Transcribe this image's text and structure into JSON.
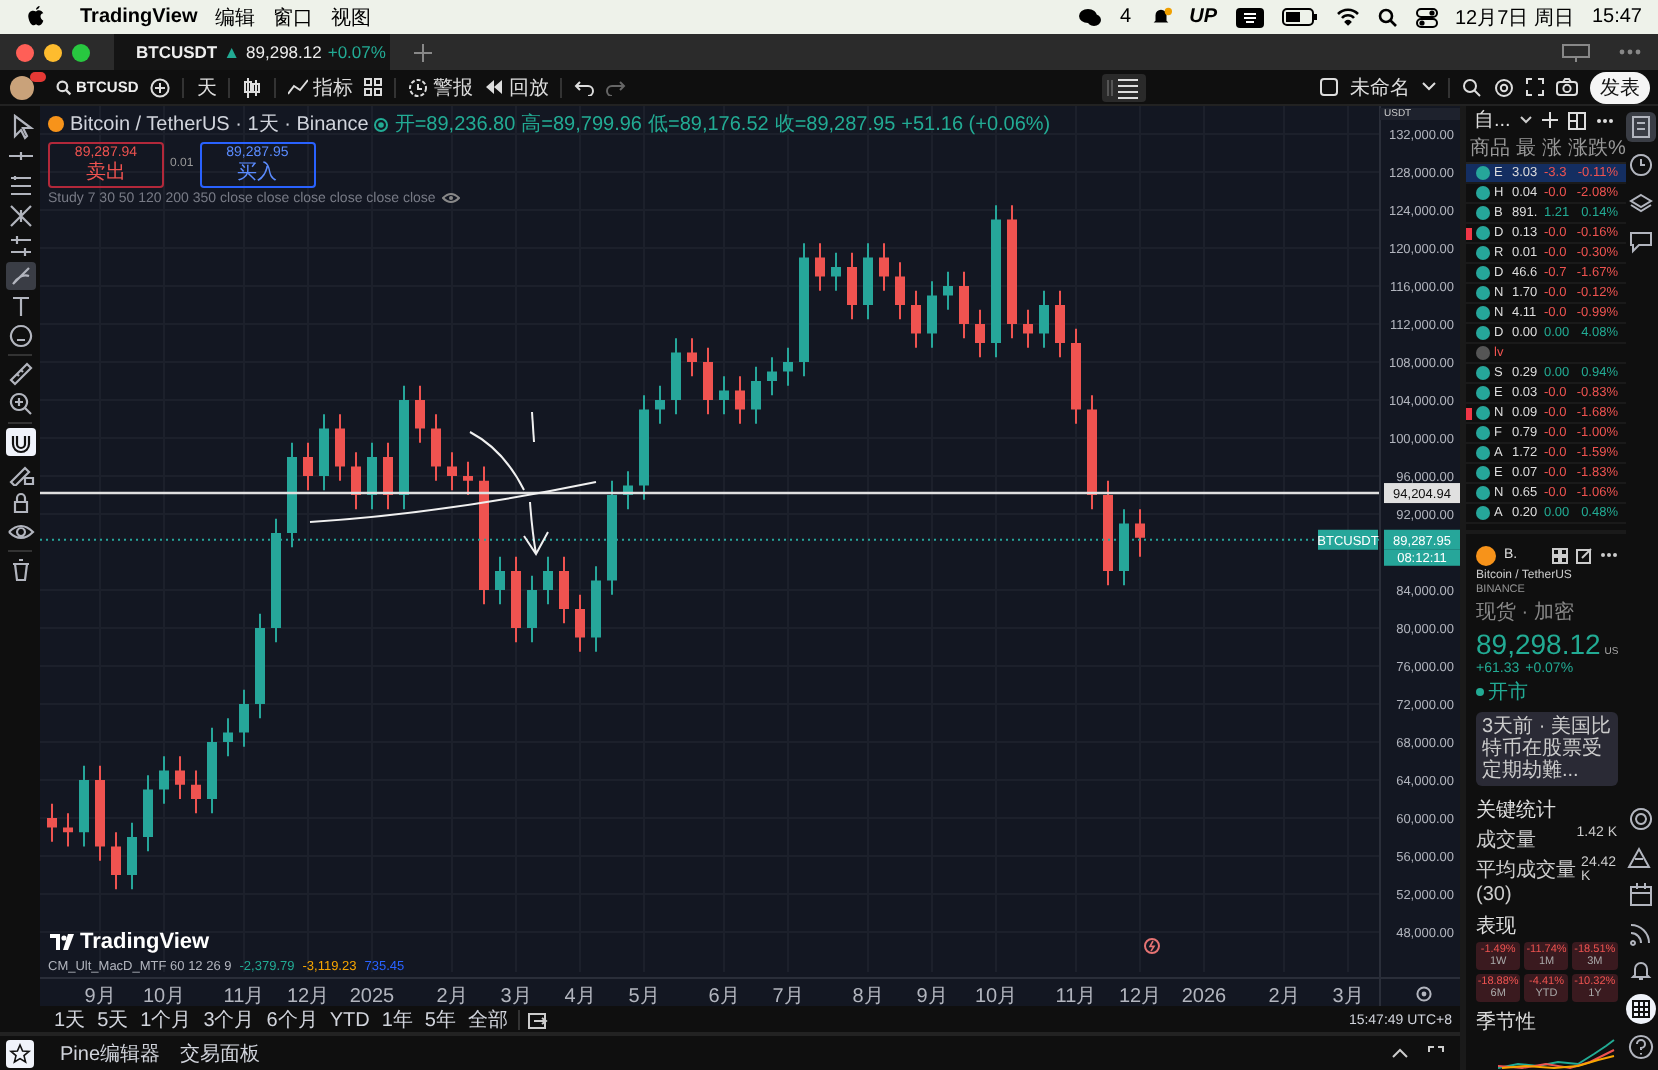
{
  "menu_bar": {
    "app": "TradingView",
    "menus": [
      "编辑",
      "窗口",
      "视图"
    ],
    "wechat_count": "4",
    "up_label": "UP",
    "date": "12月7日 周日",
    "time": "15:47"
  },
  "tab": {
    "symbol": "BTCUSDT",
    "arrow": "▲",
    "price": "89,298.12",
    "change": "+0.07%"
  },
  "toolbar": {
    "symbol": "BTCUSD",
    "interval": "天",
    "indicators": "指标",
    "alert": "警报",
    "replay": "回放",
    "layout_name": "未命名",
    "publish": "发表"
  },
  "drawing_tools": {
    "items": [
      {
        "selected": false
      },
      {
        "selected": false
      },
      {
        "selected": false
      },
      {
        "selected": false
      },
      {
        "selected": false
      },
      {
        "selected": true
      },
      {
        "selected": false
      },
      {
        "selected": false
      },
      {
        "selected": false
      },
      {
        "selected": false
      },
      {
        "selected": true
      },
      {
        "selected": false
      },
      {
        "selected": false
      },
      {
        "selected": false
      },
      {
        "selected": false
      }
    ]
  },
  "chart": {
    "legend": {
      "title": "Bitcoin / TetherUS · 1天 · Binance",
      "ohlc": [
        "开=89,236.80",
        "高=89,799.96",
        "低=89,176.52",
        "收=89,287.95"
      ],
      "change": "+51.16 (+0.06%)",
      "sell": {
        "price": "89,287.94",
        "label": "卖出"
      },
      "spread": "0.01",
      "buy": {
        "price": "89,287.95",
        "label": "买入"
      },
      "study": "Study 7 30 50 120 200 350 close close close close close close"
    },
    "unit": "USDT",
    "logo": "TradingView",
    "price_tag": {
      "symbol": "BTCUSDT",
      "countdown": "08:12:11"
    },
    "indicator": {
      "name": "CM_Ult_MacD_MTF 60 12 26 9",
      "values": [
        {
          "text": "-2,379.79",
          "color": "#22ab94"
        },
        {
          "text": "-3,119.23",
          "color": "#f7a600"
        },
        {
          "text": "735.45",
          "color": "#2962ff"
        }
      ]
    },
    "chart_data": {
      "type": "candlestick",
      "grid": true,
      "ylim": [
        43789,
        134947
      ],
      "categories": [
        null,
        null,
        null,
        "9月",
        null,
        null,
        null,
        "10月",
        null,
        null,
        null,
        null,
        "11月",
        null,
        null,
        null,
        "12月",
        null,
        null,
        null,
        "2025",
        null,
        null,
        null,
        null,
        "2月",
        null,
        null,
        null,
        "3月",
        null,
        null,
        null,
        "4月",
        null,
        null,
        null,
        "5月",
        null,
        null,
        null,
        null,
        "6月",
        null,
        null,
        null,
        "7月",
        null,
        null,
        null,
        null,
        "8月",
        null,
        null,
        null,
        "9月",
        null,
        null,
        null,
        "10月",
        null,
        null,
        null,
        null,
        "11月",
        null,
        null,
        null,
        "12月",
        null,
        null,
        null,
        "2026",
        null,
        null,
        null,
        null,
        "2月",
        null,
        null,
        null,
        "3月"
      ],
      "ohlc": [
        [
          60000,
          61500,
          57500,
          59000
        ],
        [
          59000,
          60500,
          57000,
          58500
        ],
        [
          58500,
          65500,
          57000,
          64000
        ],
        [
          64000,
          65500,
          55500,
          57000
        ],
        [
          57000,
          58500,
          52500,
          54000
        ],
        [
          54000,
          59500,
          52500,
          58000
        ],
        [
          58000,
          64500,
          56500,
          63000
        ],
        [
          63000,
          66500,
          61500,
          65000
        ],
        [
          65000,
          66500,
          62000,
          63500
        ],
        [
          63500,
          65000,
          60500,
          62000
        ],
        [
          62000,
          69500,
          60500,
          68000
        ],
        [
          68000,
          70500,
          66500,
          69000
        ],
        [
          69000,
          73500,
          67500,
          72000
        ],
        [
          72000,
          81500,
          70500,
          80000
        ],
        [
          80000,
          91500,
          78500,
          90000
        ],
        [
          90000,
          99500,
          88500,
          98000
        ],
        [
          98000,
          99500,
          94500,
          96000
        ],
        [
          96000,
          102500,
          94500,
          101000
        ],
        [
          101000,
          102500,
          95500,
          97000
        ],
        [
          97000,
          98500,
          92500,
          94000
        ],
        [
          94000,
          99500,
          92500,
          98000
        ],
        [
          98000,
          99500,
          92500,
          94000
        ],
        [
          94000,
          105500,
          92500,
          104000
        ],
        [
          104000,
          105500,
          99500,
          101000
        ],
        [
          101000,
          102500,
          95500,
          97000
        ],
        [
          97000,
          98500,
          94500,
          96000
        ],
        [
          96000,
          97500,
          94000,
          95500
        ],
        [
          95500,
          97000,
          82500,
          84000
        ],
        [
          84000,
          87500,
          82500,
          86000
        ],
        [
          86000,
          87500,
          78500,
          80000
        ],
        [
          80000,
          85500,
          78500,
          84000
        ],
        [
          84000,
          87500,
          82500,
          86000
        ],
        [
          86000,
          87500,
          80500,
          82000
        ],
        [
          82000,
          83500,
          77500,
          79000
        ],
        [
          79000,
          86500,
          77500,
          85000
        ],
        [
          85000,
          95500,
          83500,
          94000
        ],
        [
          94000,
          96500,
          92500,
          95000
        ],
        [
          95000,
          104500,
          93500,
          103000
        ],
        [
          103000,
          105500,
          101500,
          104000
        ],
        [
          104000,
          110500,
          102500,
          109000
        ],
        [
          109000,
          110500,
          106500,
          108000
        ],
        [
          108000,
          109500,
          102500,
          104000
        ],
        [
          104000,
          106500,
          102500,
          105000
        ],
        [
          105000,
          106500,
          101500,
          103000
        ],
        [
          103000,
          107500,
          101500,
          106000
        ],
        [
          106000,
          108500,
          104500,
          107000
        ],
        [
          107000,
          109500,
          105500,
          108000
        ],
        [
          108000,
          120500,
          106500,
          119000
        ],
        [
          119000,
          120500,
          115500,
          117000
        ],
        [
          117000,
          119500,
          115500,
          118000
        ],
        [
          118000,
          119500,
          112500,
          114000
        ],
        [
          114000,
          120500,
          112500,
          119000
        ],
        [
          119000,
          120500,
          115500,
          117000
        ],
        [
          117000,
          118500,
          112500,
          114000
        ],
        [
          114000,
          115500,
          109500,
          111000
        ],
        [
          111000,
          116500,
          109500,
          115000
        ],
        [
          115000,
          117500,
          113500,
          116000
        ],
        [
          116000,
          117500,
          110500,
          112000
        ],
        [
          112000,
          113500,
          108500,
          110000
        ],
        [
          110000,
          124500,
          108500,
          123000
        ],
        [
          123000,
          124500,
          110500,
          112000
        ],
        [
          112000,
          113500,
          109500,
          111000
        ],
        [
          111000,
          115500,
          109500,
          114000
        ],
        [
          114000,
          115500,
          108500,
          110000
        ],
        [
          110000,
          111500,
          101500,
          103000
        ],
        [
          103000,
          104500,
          92500,
          94000
        ],
        [
          94000,
          95500,
          84500,
          86000
        ],
        [
          86000,
          92500,
          84500,
          91000
        ],
        [
          91000,
          92500,
          87500,
          89500
        ],
        null,
        null,
        null,
        null,
        null,
        null,
        null,
        null,
        null,
        null,
        null,
        null,
        null
      ],
      "yticks": [
        {
          "value": 132000,
          "label": "132,000.00"
        },
        {
          "value": 128000,
          "label": "128,000.00"
        },
        {
          "value": 124000,
          "label": "124,000.00"
        },
        {
          "value": 120000,
          "label": "120,000.00"
        },
        {
          "value": 116000,
          "label": "116,000.00"
        },
        {
          "value": 112000,
          "label": "112,000.00"
        },
        {
          "value": 108000,
          "label": "108,000.00"
        },
        {
          "value": 104000,
          "label": "104,000.00"
        },
        {
          "value": 100000,
          "label": "100,000.00"
        },
        {
          "value": 96000,
          "label": "96,000.00"
        },
        {
          "value": 92000,
          "label": "92,000.00"
        },
        {
          "value": 84000,
          "label": "84,000.00"
        },
        {
          "value": 80000,
          "label": "80,000.00"
        },
        {
          "value": 76000,
          "label": "76,000.00"
        },
        {
          "value": 72000,
          "label": "72,000.00"
        },
        {
          "value": 68000,
          "label": "68,000.00"
        },
        {
          "value": 64000,
          "label": "64,000.00"
        },
        {
          "value": 60000,
          "label": "60,000.00"
        },
        {
          "value": 56000,
          "label": "56,000.00"
        },
        {
          "value": 52000,
          "label": "52,000.00"
        },
        {
          "value": 48000,
          "label": "48,000.00"
        }
      ],
      "ref_lines": [
        {
          "axis": "y",
          "value": 94204.94,
          "label": "94,204.94",
          "color": "#e0e0e0"
        },
        {
          "axis": "y",
          "value": 89287.95,
          "label": "89,287.95",
          "color": "#26a69a"
        }
      ]
    }
  },
  "range_bar": {
    "ranges": [
      "1天",
      "5天",
      "1个月",
      "3个月",
      "6个月",
      "YTD",
      "1年",
      "5年",
      "全部"
    ],
    "clock": "15:47:49 UTC+8"
  },
  "bottom_tabs": [
    "Pine编辑器",
    "交易面板"
  ],
  "watchlist": {
    "title": "自...",
    "columns": [
      "商品",
      "最",
      "涨",
      "涨跌%"
    ],
    "rows": [
      {
        "kind": "symbol",
        "symbol": "E",
        "last": "3.03",
        "change": "-3.3",
        "percent": "-0.11%",
        "up": false,
        "selected": true,
        "flagged": false
      },
      {
        "kind": "symbol",
        "symbol": "H",
        "last": "0.04",
        "change": "-0.0",
        "percent": "-2.08%",
        "up": false,
        "selected": false,
        "flagged": false
      },
      {
        "kind": "symbol",
        "symbol": "B",
        "last": "891.",
        "change": "1.21",
        "percent": "0.14%",
        "up": true,
        "selected": false,
        "flagged": false
      },
      {
        "kind": "symbol",
        "symbol": "D",
        "last": "0.13",
        "change": "-0.0",
        "percent": "-0.16%",
        "up": false,
        "selected": false,
        "flagged": true
      },
      {
        "kind": "symbol",
        "symbol": "R",
        "last": "0.01",
        "change": "-0.0",
        "percent": "-0.30%",
        "up": false,
        "selected": false,
        "flagged": false
      },
      {
        "kind": "symbol",
        "symbol": "D",
        "last": "46.6",
        "change": "-0.7",
        "percent": "-1.67%",
        "up": false,
        "selected": false,
        "flagged": false
      },
      {
        "kind": "symbol",
        "symbol": "N",
        "last": "1.70",
        "change": "-0.0",
        "percent": "-0.12%",
        "up": false,
        "selected": false,
        "flagged": false
      },
      {
        "kind": "symbol",
        "symbol": "N",
        "last": "4.11",
        "change": "-0.0",
        "percent": "-0.99%",
        "up": false,
        "selected": false,
        "flagged": false
      },
      {
        "kind": "symbol",
        "symbol": "D",
        "last": "0.00",
        "change": "0.00",
        "percent": "4.08%",
        "up": true,
        "selected": false,
        "flagged": false
      },
      {
        "kind": "section",
        "symbol": "lv",
        "selected": false
      },
      {
        "kind": "symbol",
        "symbol": "S",
        "last": "0.29",
        "change": "0.00",
        "percent": "0.94%",
        "up": true,
        "selected": false,
        "flagged": false
      },
      {
        "kind": "symbol",
        "symbol": "E",
        "last": "0.03",
        "change": "-0.0",
        "percent": "-0.83%",
        "up": false,
        "selected": false,
        "flagged": false
      },
      {
        "kind": "symbol",
        "symbol": "N",
        "last": "0.09",
        "change": "-0.0",
        "percent": "-1.68%",
        "up": false,
        "selected": false,
        "flagged": true
      },
      {
        "kind": "symbol",
        "symbol": "F",
        "last": "0.79",
        "change": "-0.0",
        "percent": "-1.00%",
        "up": false,
        "selected": false,
        "flagged": false
      },
      {
        "kind": "symbol",
        "symbol": "A",
        "last": "1.72",
        "change": "-0.0",
        "percent": "-1.59%",
        "up": false,
        "selected": false,
        "flagged": false
      },
      {
        "kind": "symbol",
        "symbol": "E",
        "last": "0.07",
        "change": "-0.0",
        "percent": "-1.83%",
        "up": false,
        "selected": false,
        "flagged": false
      },
      {
        "kind": "symbol",
        "symbol": "N",
        "last": "0.65",
        "change": "-0.0",
        "percent": "-1.06%",
        "up": false,
        "selected": false,
        "flagged": false
      },
      {
        "kind": "symbol",
        "symbol": "A",
        "last": "0.20",
        "change": "0.00",
        "percent": "0.48%",
        "up": true,
        "selected": false,
        "flagged": false
      }
    ]
  },
  "details": {
    "symbol": "B.",
    "name": "Bitcoin / TetherUS",
    "exchange": "BINANCE",
    "category": "现货 · 加密",
    "price": "89,298.12",
    "currency": "US",
    "change": "+61.33",
    "percent": "+0.07%",
    "market_status": "开市",
    "news": "3天前 · 美国比特币在股票受定期劫難...",
    "stats_title": "关键统计",
    "stats": [
      {
        "label": "成交量",
        "value": "1.42 K"
      },
      {
        "label": "平均成交量 (30)",
        "value": "24.42 K"
      }
    ],
    "performance_title": "表现",
    "performance": [
      {
        "value": "-1.49%",
        "period": "1W",
        "up": false
      },
      {
        "value": "-11.74%",
        "period": "1M",
        "up": false
      },
      {
        "value": "-18.51%",
        "period": "3M",
        "up": false
      },
      {
        "value": "-18.88%",
        "period": "6M",
        "up": false
      },
      {
        "value": "-4.41%",
        "period": "YTD",
        "up": false
      },
      {
        "value": "-10.32%",
        "period": "1Y",
        "up": false
      }
    ],
    "seasonality_title": "季节性"
  },
  "side_icons": [
    {
      "selected": true
    },
    {
      "selected": false
    },
    {
      "selected": false
    },
    {
      "selected": false
    },
    {
      "selected": false
    },
    {
      "selected": false
    },
    {
      "selected": false
    },
    {
      "selected": false
    },
    {
      "selected": false
    },
    {
      "selected": true
    },
    {
      "selected": false
    }
  ]
}
